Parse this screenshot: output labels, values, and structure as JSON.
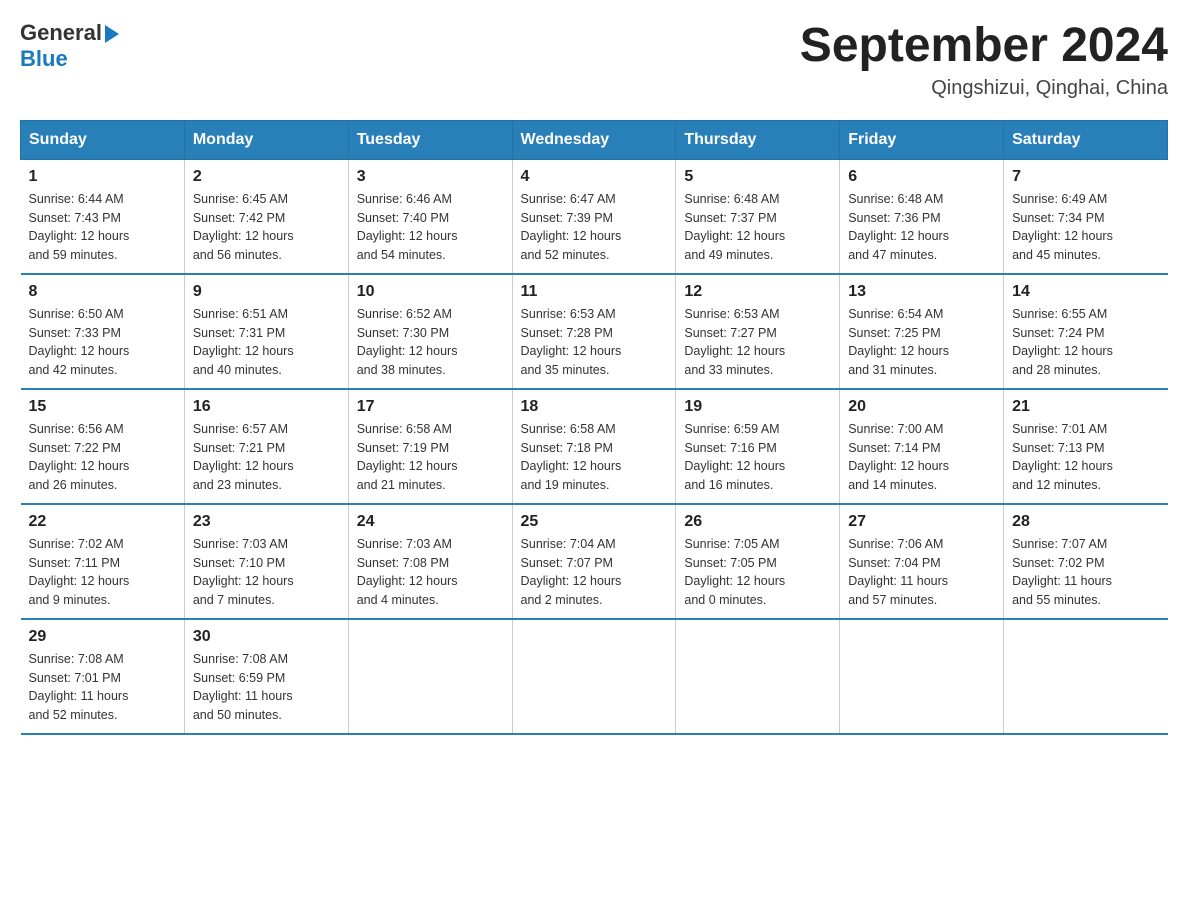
{
  "header": {
    "logo_general": "General",
    "logo_blue": "Blue",
    "month_year": "September 2024",
    "location": "Qingshizui, Qinghai, China"
  },
  "days_of_week": [
    "Sunday",
    "Monday",
    "Tuesday",
    "Wednesday",
    "Thursday",
    "Friday",
    "Saturday"
  ],
  "weeks": [
    [
      {
        "day": "1",
        "sunrise": "6:44 AM",
        "sunset": "7:43 PM",
        "daylight": "12 hours and 59 minutes."
      },
      {
        "day": "2",
        "sunrise": "6:45 AM",
        "sunset": "7:42 PM",
        "daylight": "12 hours and 56 minutes."
      },
      {
        "day": "3",
        "sunrise": "6:46 AM",
        "sunset": "7:40 PM",
        "daylight": "12 hours and 54 minutes."
      },
      {
        "day": "4",
        "sunrise": "6:47 AM",
        "sunset": "7:39 PM",
        "daylight": "12 hours and 52 minutes."
      },
      {
        "day": "5",
        "sunrise": "6:48 AM",
        "sunset": "7:37 PM",
        "daylight": "12 hours and 49 minutes."
      },
      {
        "day": "6",
        "sunrise": "6:48 AM",
        "sunset": "7:36 PM",
        "daylight": "12 hours and 47 minutes."
      },
      {
        "day": "7",
        "sunrise": "6:49 AM",
        "sunset": "7:34 PM",
        "daylight": "12 hours and 45 minutes."
      }
    ],
    [
      {
        "day": "8",
        "sunrise": "6:50 AM",
        "sunset": "7:33 PM",
        "daylight": "12 hours and 42 minutes."
      },
      {
        "day": "9",
        "sunrise": "6:51 AM",
        "sunset": "7:31 PM",
        "daylight": "12 hours and 40 minutes."
      },
      {
        "day": "10",
        "sunrise": "6:52 AM",
        "sunset": "7:30 PM",
        "daylight": "12 hours and 38 minutes."
      },
      {
        "day": "11",
        "sunrise": "6:53 AM",
        "sunset": "7:28 PM",
        "daylight": "12 hours and 35 minutes."
      },
      {
        "day": "12",
        "sunrise": "6:53 AM",
        "sunset": "7:27 PM",
        "daylight": "12 hours and 33 minutes."
      },
      {
        "day": "13",
        "sunrise": "6:54 AM",
        "sunset": "7:25 PM",
        "daylight": "12 hours and 31 minutes."
      },
      {
        "day": "14",
        "sunrise": "6:55 AM",
        "sunset": "7:24 PM",
        "daylight": "12 hours and 28 minutes."
      }
    ],
    [
      {
        "day": "15",
        "sunrise": "6:56 AM",
        "sunset": "7:22 PM",
        "daylight": "12 hours and 26 minutes."
      },
      {
        "day": "16",
        "sunrise": "6:57 AM",
        "sunset": "7:21 PM",
        "daylight": "12 hours and 23 minutes."
      },
      {
        "day": "17",
        "sunrise": "6:58 AM",
        "sunset": "7:19 PM",
        "daylight": "12 hours and 21 minutes."
      },
      {
        "day": "18",
        "sunrise": "6:58 AM",
        "sunset": "7:18 PM",
        "daylight": "12 hours and 19 minutes."
      },
      {
        "day": "19",
        "sunrise": "6:59 AM",
        "sunset": "7:16 PM",
        "daylight": "12 hours and 16 minutes."
      },
      {
        "day": "20",
        "sunrise": "7:00 AM",
        "sunset": "7:14 PM",
        "daylight": "12 hours and 14 minutes."
      },
      {
        "day": "21",
        "sunrise": "7:01 AM",
        "sunset": "7:13 PM",
        "daylight": "12 hours and 12 minutes."
      }
    ],
    [
      {
        "day": "22",
        "sunrise": "7:02 AM",
        "sunset": "7:11 PM",
        "daylight": "12 hours and 9 minutes."
      },
      {
        "day": "23",
        "sunrise": "7:03 AM",
        "sunset": "7:10 PM",
        "daylight": "12 hours and 7 minutes."
      },
      {
        "day": "24",
        "sunrise": "7:03 AM",
        "sunset": "7:08 PM",
        "daylight": "12 hours and 4 minutes."
      },
      {
        "day": "25",
        "sunrise": "7:04 AM",
        "sunset": "7:07 PM",
        "daylight": "12 hours and 2 minutes."
      },
      {
        "day": "26",
        "sunrise": "7:05 AM",
        "sunset": "7:05 PM",
        "daylight": "12 hours and 0 minutes."
      },
      {
        "day": "27",
        "sunrise": "7:06 AM",
        "sunset": "7:04 PM",
        "daylight": "11 hours and 57 minutes."
      },
      {
        "day": "28",
        "sunrise": "7:07 AM",
        "sunset": "7:02 PM",
        "daylight": "11 hours and 55 minutes."
      }
    ],
    [
      {
        "day": "29",
        "sunrise": "7:08 AM",
        "sunset": "7:01 PM",
        "daylight": "11 hours and 52 minutes."
      },
      {
        "day": "30",
        "sunrise": "7:08 AM",
        "sunset": "6:59 PM",
        "daylight": "11 hours and 50 minutes."
      },
      null,
      null,
      null,
      null,
      null
    ]
  ],
  "labels": {
    "sunrise": "Sunrise:",
    "sunset": "Sunset:",
    "daylight": "Daylight:"
  }
}
